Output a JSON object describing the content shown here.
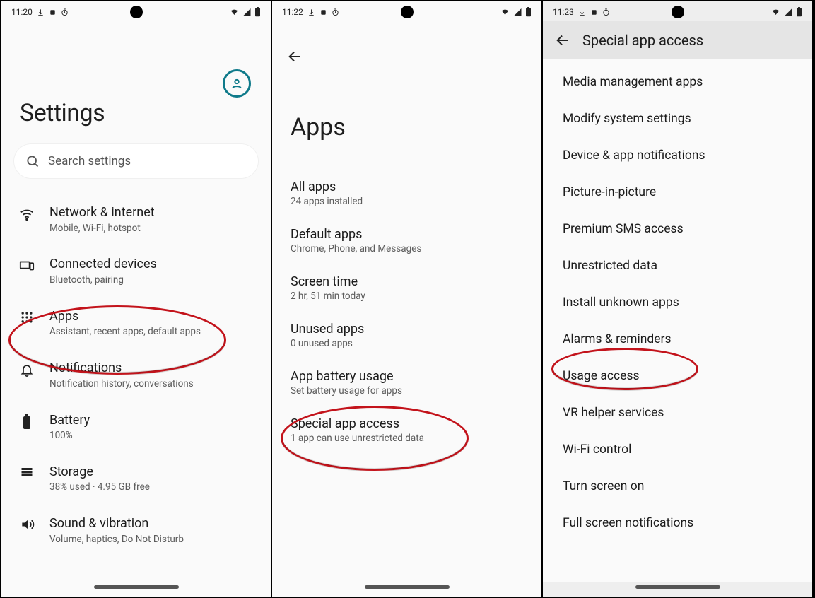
{
  "screens": [
    {
      "time": "11:20",
      "title": "Settings",
      "search_placeholder": "Search settings",
      "items": [
        {
          "icon": "wifi",
          "title": "Network & internet",
          "sub": "Mobile, Wi-Fi, hotspot"
        },
        {
          "icon": "devices",
          "title": "Connected devices",
          "sub": "Bluetooth, pairing"
        },
        {
          "icon": "apps",
          "title": "Apps",
          "sub": "Assistant, recent apps, default apps",
          "highlighted": true
        },
        {
          "icon": "bell",
          "title": "Notifications",
          "sub": "Notification history, conversations"
        },
        {
          "icon": "battery",
          "title": "Battery",
          "sub": "100%"
        },
        {
          "icon": "storage",
          "title": "Storage",
          "sub": "38% used · 4.95 GB free"
        },
        {
          "icon": "sound",
          "title": "Sound & vibration",
          "sub": "Volume, haptics, Do Not Disturb"
        }
      ]
    },
    {
      "time": "11:22",
      "title": "Apps",
      "items": [
        {
          "title": "All apps",
          "sub": "24 apps installed"
        },
        {
          "title": "Default apps",
          "sub": "Chrome, Phone, and Messages"
        },
        {
          "title": "Screen time",
          "sub": "2 hr, 51 min today"
        },
        {
          "title": "Unused apps",
          "sub": "0 unused apps"
        },
        {
          "title": "App battery usage",
          "sub": "Set battery usage for apps"
        },
        {
          "title": "Special app access",
          "sub": "1 app can use unrestricted data",
          "highlighted": true
        }
      ]
    },
    {
      "time": "11:23",
      "topbar_title": "Special app access",
      "items": [
        "Media management apps",
        "Modify system settings",
        "Device & app notifications",
        "Picture-in-picture",
        "Premium SMS access",
        "Unrestricted data",
        "Install unknown apps",
        "Alarms & reminders",
        "Usage access",
        "VR helper services",
        "Wi-Fi control",
        "Turn screen on",
        "Full screen notifications"
      ],
      "highlight_item": "Alarms & reminders"
    }
  ],
  "status_icons": [
    "download",
    "screenshot",
    "timer",
    "wifi",
    "signal",
    "battery"
  ]
}
